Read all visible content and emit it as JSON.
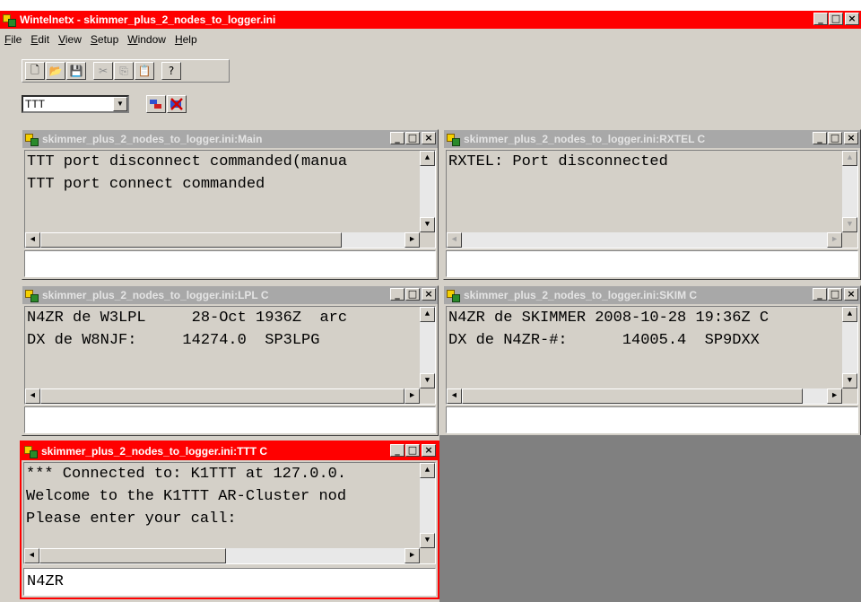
{
  "app": {
    "title": "Wintelnetx - skimmer_plus_2_nodes_to_logger.ini",
    "min": "_",
    "max": "□",
    "close": "×"
  },
  "menu": [
    "File",
    "Edit",
    "View",
    "Setup",
    "Window",
    "Help"
  ],
  "menu_underline": [
    "F",
    "E",
    "V",
    "S",
    "W",
    "H"
  ],
  "toolbar": {
    "new_icon": "🗋",
    "open_icon": "📂",
    "save_icon": "💾",
    "cut_icon": "✂",
    "copy_icon": "⎘",
    "paste_icon": "📋",
    "help_icon": "?"
  },
  "combo": {
    "value": "TTT"
  },
  "windows": {
    "main": {
      "title": "skimmer_plus_2_nodes_to_logger.ini:Main",
      "lines": [
        "TTT port disconnect commanded(manua",
        "TTT port connect commanded"
      ],
      "input": ""
    },
    "rxtel": {
      "title": "skimmer_plus_2_nodes_to_logger.ini:RXTEL C",
      "lines": [
        "RXTEL: Port disconnected"
      ],
      "input": ""
    },
    "lpl": {
      "title": "skimmer_plus_2_nodes_to_logger.ini:LPL C",
      "lines": [
        "N4ZR de W3LPL     28-Oct 1936Z  arc",
        "DX de W8NJF:     14274.0  SP3LPG"
      ],
      "input": ""
    },
    "skim": {
      "title": "skimmer_plus_2_nodes_to_logger.ini:SKIM C",
      "lines": [
        "N4ZR de SKIMMER 2008-10-28 19:36Z C",
        "DX de N4ZR-#:      14005.4  SP9DXX"
      ],
      "input": ""
    },
    "ttt": {
      "title": "skimmer_plus_2_nodes_to_logger.ini:TTT C",
      "lines": [
        "*** Connected to: K1TTT at 127.0.0.",
        "Welcome to the K1TTT AR-Cluster nod",
        "Please enter your call:"
      ],
      "input": "N4ZR"
    }
  },
  "colors": {
    "active_titlebar": "#ff0000",
    "inactive_titlebar": "#a8a8a8",
    "face": "#d4d0c8",
    "mdi_background": "#808080"
  }
}
